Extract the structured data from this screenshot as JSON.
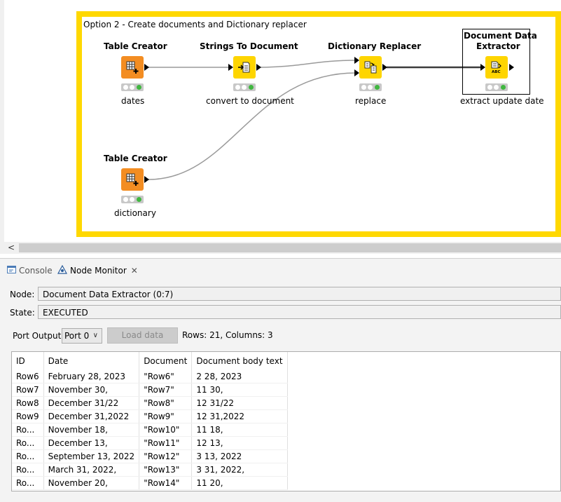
{
  "workflow": {
    "annotation": "Option 2 - Create documents and Dictionary replacer",
    "nodes": [
      {
        "title": "Table Creator",
        "label": "dates"
      },
      {
        "title": "Strings To Document",
        "label": "convert to document"
      },
      {
        "title": "Dictionary Replacer",
        "label": "replace"
      },
      {
        "title_line1": "Document Data",
        "title_line2": "Extractor",
        "label": "extract update date"
      },
      {
        "title": "Table Creator",
        "label": "dictionary"
      }
    ],
    "colors": {
      "annotation_border": "#ffd800",
      "source_node": "#f38d22",
      "manipulator_node": "#fed500",
      "status_ok": "#40b740"
    }
  },
  "scrollbar": {
    "left_arrow": "<"
  },
  "panel": {
    "tabs": [
      {
        "label": "Console",
        "icon": "console-icon"
      },
      {
        "label": "Node Monitor",
        "icon": "node-monitor-icon",
        "close": "✕"
      }
    ],
    "node_label": "Node:",
    "node_value": "Document Data Extractor  (0:7)",
    "state_label": "State:",
    "state_value": "EXECUTED",
    "port_label": "Port Output",
    "port_value": "Port 0",
    "load_button": "Load data",
    "rows_info": "Rows: 21, Columns: 3",
    "table": {
      "headers": [
        "ID",
        "Date",
        "Document",
        "Document body text"
      ],
      "rows": [
        [
          "Row6",
          "February 28, 2023",
          "\"Row6\"",
          "2 28, 2023"
        ],
        [
          "Row7",
          "November 30,",
          "\"Row7\"",
          "11 30,"
        ],
        [
          "Row8",
          "December 31/22",
          "\"Row8\"",
          "12 31/22"
        ],
        [
          "Row9",
          "December 31,2022",
          "\"Row9\"",
          "12 31,2022"
        ],
        [
          "Ro...",
          "November 18,",
          "\"Row10\"",
          "11 18,"
        ],
        [
          "Ro...",
          "December 13,",
          "\"Row11\"",
          "12 13,"
        ],
        [
          "Ro...",
          "September 13, 2022",
          "\"Row12\"",
          "3 13, 2022"
        ],
        [
          "Ro...",
          "March 31, 2022,",
          "\"Row13\"",
          "3 31, 2022,"
        ],
        [
          "Ro...",
          "November 20,",
          "\"Row14\"",
          "11 20,"
        ]
      ]
    }
  }
}
